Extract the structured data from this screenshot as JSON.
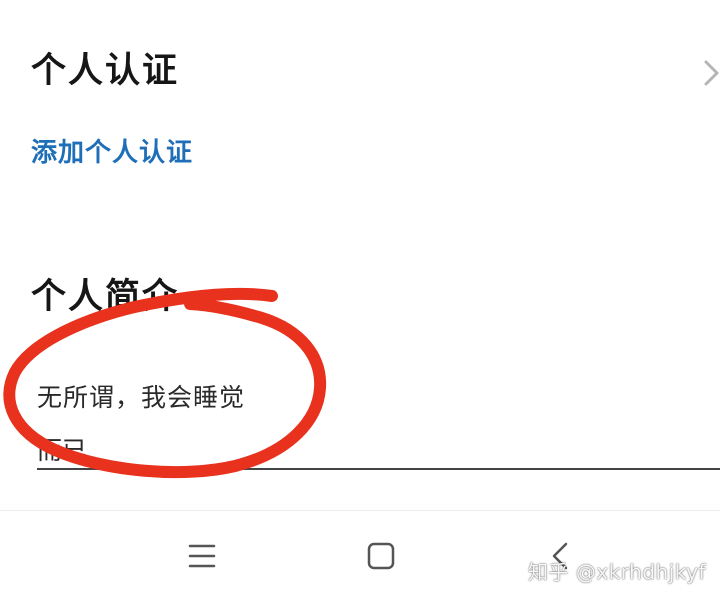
{
  "certification": {
    "title": "个人认证",
    "add_link": "添加个人认证",
    "chevron_icon": "chevron-right-icon"
  },
  "bio": {
    "title": "个人简介",
    "value_line1": "无所谓，我会睡觉",
    "value_line2": "而已"
  },
  "navbar": {
    "menu_icon": "menu-icon",
    "home_icon": "home-square-icon",
    "back_icon": "back-arrow-icon"
  },
  "watermark": {
    "text": "知乎 @xkrhdhjkyf"
  },
  "annotation": {
    "color": "#e8321e",
    "shape": "hand-drawn-circle"
  },
  "colors": {
    "link": "#1f6fb8",
    "text": "#161616",
    "annotation": "#e8321e"
  }
}
